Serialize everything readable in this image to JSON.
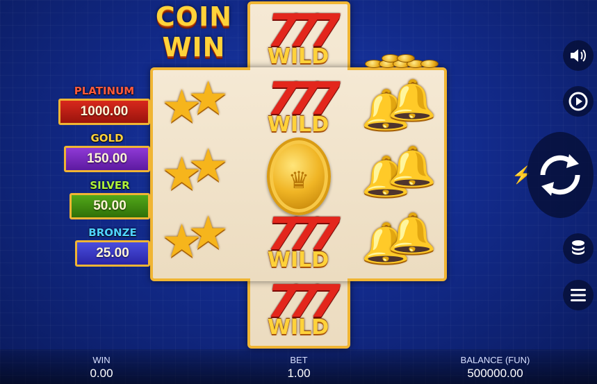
{
  "game": {
    "logo_line1": "COIN",
    "logo_line2": "WIN"
  },
  "jackpots": [
    {
      "label": "PLATINUM",
      "value": "1000.00",
      "label_color": "#ff5a3a",
      "box_color": "#b51a12"
    },
    {
      "label": "GOLD",
      "value": "150.00",
      "label_color": "#ffd23a",
      "box_color": "#7a2ac4"
    },
    {
      "label": "SILVER",
      "value": "50.00",
      "label_color": "#aef23c",
      "box_color": "#3f8d12"
    },
    {
      "label": "BRONZE",
      "value": "25.00",
      "label_color": "#4fd2ff",
      "box_color": "#3336c6"
    }
  ],
  "reels": {
    "wild_text": "WILD",
    "sevens_text": "777",
    "symbols": [
      "stars",
      "wild",
      "bells",
      "coin"
    ]
  },
  "controls": {
    "sound": "speaker-icon",
    "autoplay": "autoplay-icon",
    "spin": "spin-icon",
    "turbo": "lightning-icon",
    "bet": "coin-stack-icon",
    "menu": "hamburger-menu-icon"
  },
  "status_bar": {
    "win_label": "WIN",
    "win_value": "0.00",
    "bet_label": "BET",
    "bet_value": "1.00",
    "balance_label": "BALANCE (FUN)",
    "balance_value": "500000.00"
  },
  "colors": {
    "frame_gold": "#f0b533",
    "reel_bg": "#f5e9d4",
    "background_blue": "#122a8a"
  }
}
